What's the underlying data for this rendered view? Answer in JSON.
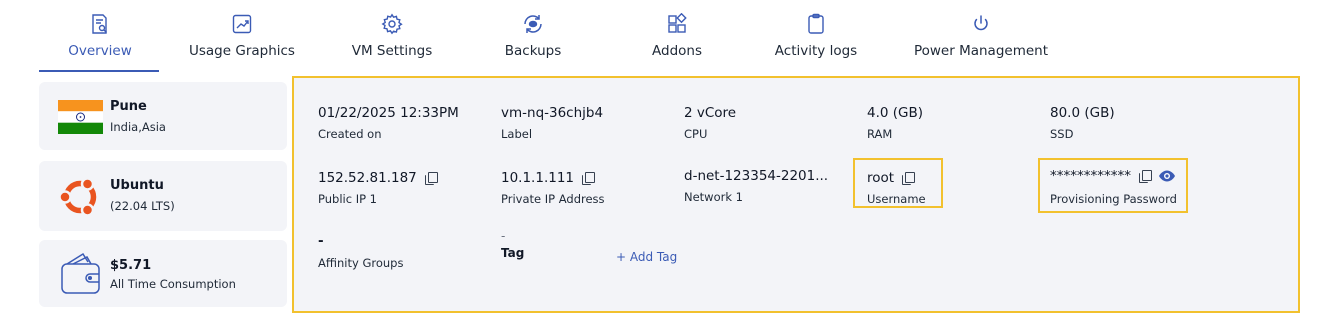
{
  "tabs": [
    {
      "label": "Overview",
      "icon": "overview-icon",
      "active": true
    },
    {
      "label": "Usage Graphics",
      "icon": "chart-icon"
    },
    {
      "label": "VM Settings",
      "icon": "gear-icon"
    },
    {
      "label": "Backups",
      "icon": "backup-icon"
    },
    {
      "label": "Addons",
      "icon": "addons-icon"
    },
    {
      "label": "Activity logs",
      "icon": "clipboard-icon"
    },
    {
      "label": "Power Management",
      "icon": "power-icon"
    }
  ],
  "location": {
    "city": "Pune",
    "region": "India,Asia",
    "flag": "india-flag-icon"
  },
  "os": {
    "name": "Ubuntu",
    "version": "(22.04 LTS)",
    "icon": "ubuntu-icon"
  },
  "consumption": {
    "amount": "$5.71",
    "label": "All Time Consumption",
    "icon": "wallet-icon"
  },
  "details": {
    "created_on": {
      "value": "01/22/2025 12:33PM",
      "label": "Created on"
    },
    "label": {
      "value": "vm-nq-36chjb4",
      "label": "Label"
    },
    "cpu": {
      "value": "2 vCore",
      "label": "CPU"
    },
    "ram": {
      "value": "4.0 (GB)",
      "label": "RAM"
    },
    "ssd": {
      "value": "80.0 (GB)",
      "label": "SSD"
    },
    "public_ip": {
      "value": "152.52.81.187",
      "label": "Public IP 1"
    },
    "private_ip": {
      "value": "10.1.1.111",
      "label": "Private IP Address"
    },
    "network": {
      "value": "d-net-123354-2201...",
      "label": "Network 1"
    },
    "username": {
      "value": "root",
      "label": "Username"
    },
    "password": {
      "value": "************",
      "label": "Provisioning Password"
    },
    "affinity": {
      "value": "-",
      "label": "Affinity Groups"
    },
    "tag": {
      "value": "-",
      "label": "Tag",
      "add_label": "+ Add Tag"
    }
  },
  "colors": {
    "accent": "#3b5bb5",
    "highlight": "#f2c12e",
    "panel_bg": "#f3f4f8"
  }
}
